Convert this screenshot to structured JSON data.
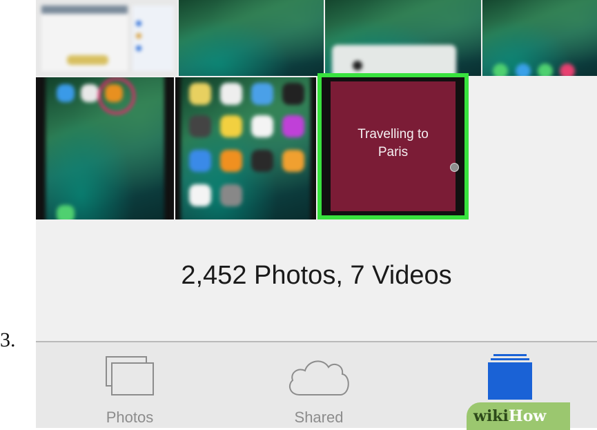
{
  "step": {
    "number": "3."
  },
  "grid": {
    "selected_video": {
      "title": "Travelling to\nParis",
      "highlight_color": "#38e23e",
      "background_color": "#7b1c36"
    }
  },
  "library": {
    "summary": "2,452 Photos, 7 Videos"
  },
  "tabbar": {
    "tabs": [
      {
        "label": "Photos",
        "icon": "photos-stack-icon",
        "selected": false
      },
      {
        "label": "Shared",
        "icon": "cloud-icon",
        "selected": false
      },
      {
        "label": "Albums",
        "icon": "albums-icon",
        "selected": true
      }
    ],
    "accent_color": "#1a62d6",
    "inactive_color": "#8c8c8c"
  },
  "watermark": {
    "wiki": "wiki",
    "how": "How"
  }
}
